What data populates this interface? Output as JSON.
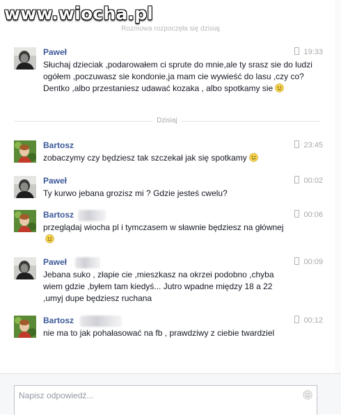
{
  "watermark": "www.wiocha.pl",
  "conversation": {
    "started_note": "Rozmowa rozpoczęła się dzisiaj",
    "divider_label": "Dzisiaj"
  },
  "messages": [
    {
      "author": "Paweł",
      "time": "19:33",
      "device": "phone-icon",
      "text": "Słuchaj dzieciak ,podarowałem ci sprute do mnie,ale ty srasz sie do ludzi ogółem ,poczuwasz sie kondonie,ja mam cie wywieść do lasu ,czy co? Dentko ,albo przestaniesz udawać kozaka , albo spotkamy sie",
      "smiley": true
    },
    {
      "author": "Bartosz",
      "time": "23:45",
      "device": "phone-icon",
      "text": "zobaczymy czy będziesz tak szczekał jak się spotkamy",
      "smiley": true
    },
    {
      "author": "Paweł",
      "time": "00:02",
      "device": "phone-icon",
      "text": "Ty kurwo jebana grozisz mi ? Gdzie jesteś cwelu?",
      "smiley": false
    },
    {
      "author": "Bartosz",
      "time": "00:06",
      "device": "phone-icon",
      "text": "przeglądaj wiocha pl i tymczasem w sławnie będziesz na głównej",
      "smiley": true
    },
    {
      "author": "Paweł",
      "time": "00:09",
      "device": "phone-icon",
      "text": "Jebana suko , złapie cie ,mieszkasz na okrzei podobno ,chyba wiem gdzie ,byłem tam kiedyś... Jutro wpadne między 18 a 22 ,umyj dupe będziesz ruchana",
      "smiley": false
    },
    {
      "author": "Bartosz",
      "time": "00:12",
      "device": "phone-icon",
      "text": "nie ma to jak pohałasować na fb , prawdziwy z ciebie twardziel",
      "smiley": false
    }
  ],
  "composer": {
    "placeholder": "Napisz odpowiedź...",
    "emoji_icon": "smiley-icon"
  },
  "colors": {
    "author": "#3b5998",
    "meta": "#a8a8a8",
    "text": "#141823"
  }
}
